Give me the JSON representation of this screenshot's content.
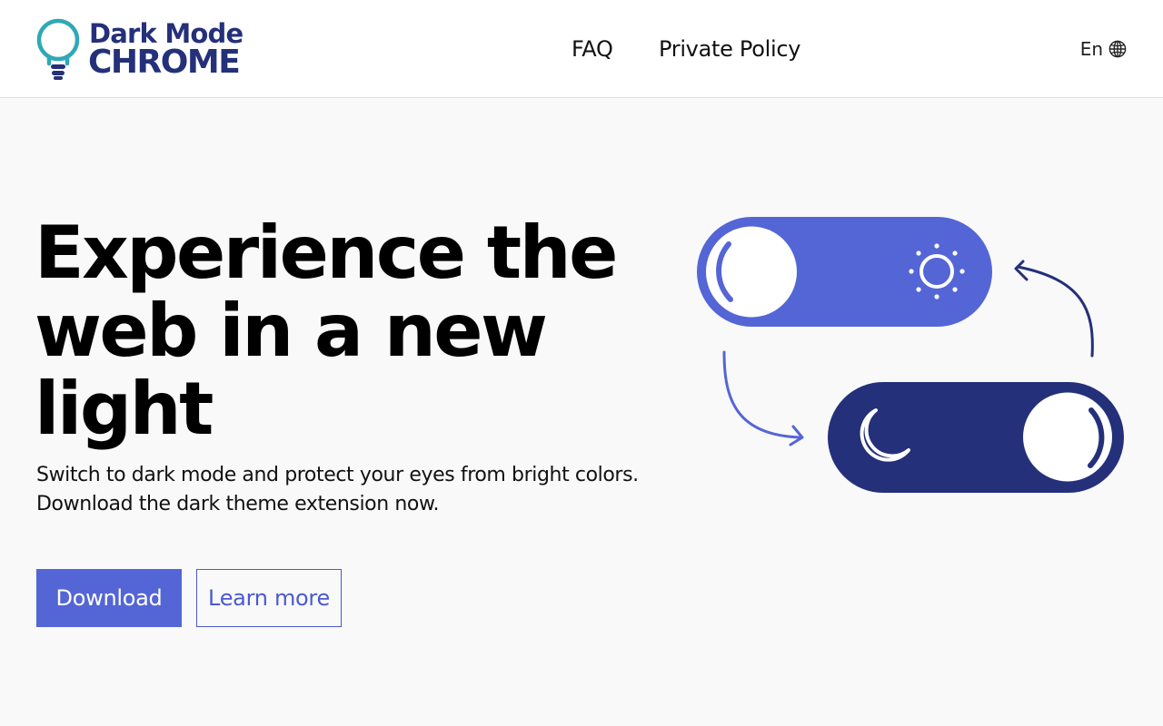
{
  "header": {
    "logo": {
      "line1": "Dark Mode",
      "line2": "CHROME"
    },
    "nav": [
      {
        "label": "FAQ"
      },
      {
        "label": "Private Policy"
      }
    ],
    "language": {
      "label": "En",
      "icon": "globe-icon"
    }
  },
  "hero": {
    "title": "Experience the web in a new light",
    "description_line1": "Switch to dark mode and protect your eyes from bright colors.",
    "description_line2": "Download the dark theme extension now.",
    "primary_button": "Download",
    "secondary_button": "Learn more"
  },
  "illustration": {
    "light_toggle_icon": "sun-icon",
    "dark_toggle_icon": "moon-icon"
  },
  "colors": {
    "brand_dark": "#24307a",
    "accent": "#5465d6",
    "bulb": "#2fa9b5",
    "light_toggle": "#5465d6",
    "dark_toggle": "#24307a",
    "background": "#f9f9f9"
  }
}
